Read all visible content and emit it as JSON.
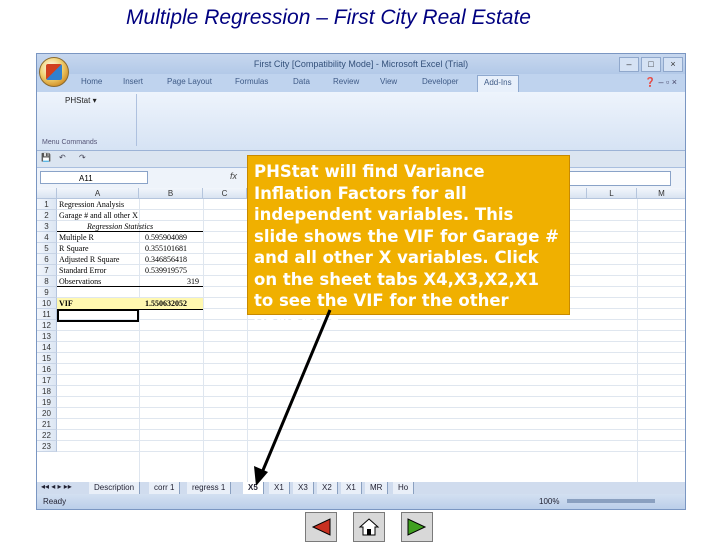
{
  "slide": {
    "title": "Multiple Regression  –   First City Real Estate"
  },
  "excel": {
    "window_title": "First City  [Compatibility Mode]  -  Microsoft Excel (Trial)",
    "ribbon_tabs": [
      "Home",
      "Insert",
      "Page Layout",
      "Formulas",
      "Data",
      "Review",
      "View",
      "Developer",
      "Add-Ins"
    ],
    "active_tab": "Add-Ins",
    "addin_menu": "PHStat ▾",
    "group_label": "Menu Commands",
    "name_box": "A11",
    "fx_symbol": "fx",
    "columns": [
      "A",
      "B",
      "C",
      "L",
      "M"
    ],
    "rows": [
      "1",
      "2",
      "3",
      "4",
      "5",
      "6",
      "7",
      "8",
      "9",
      "10",
      "11",
      "12",
      "13",
      "14",
      "15",
      "16",
      "17",
      "18",
      "19",
      "20",
      "21",
      "22",
      "23"
    ],
    "cells": {
      "a1": "Regression Analysis",
      "a2": "Garage # and all other X",
      "a3": "Regression Statistics",
      "a4": "Multiple R",
      "b4": "0.595904089",
      "a5": "R Square",
      "b5": "0.355101681",
      "a6": "Adjusted R Square",
      "b6": "0.346856418",
      "a7": "Standard Error",
      "b7": "0.539919575",
      "a8": "Observations",
      "b8": "319",
      "a9": "VIF",
      "b9": "1.550632052"
    },
    "sheet_tabs": [
      "Description",
      "corr 1",
      "regress 1",
      "X5",
      "X1",
      "X3",
      "X2",
      "X1",
      "MR",
      "Ho"
    ],
    "active_sheet": "X5",
    "status": "Ready",
    "zoom": "100%"
  },
  "callout": {
    "text": "PHStat will find Variance Inflation Factors for all independent variables. This slide shows the VIF for Garage # and all other X variables. Click on the sheet tabs X4,X3,X2,X1 to see the VIF for the other variables."
  },
  "colors": {
    "title": "#000080",
    "callout_bg": "#f0b000",
    "callout_text": "#ffffff",
    "nav_arrow_red": "#c83020",
    "nav_arrow_green": "#40a020",
    "nav_arrow_blue": "#2050b0"
  },
  "nav": {
    "buttons": [
      "previous-slide",
      "home",
      "next-slide"
    ]
  }
}
